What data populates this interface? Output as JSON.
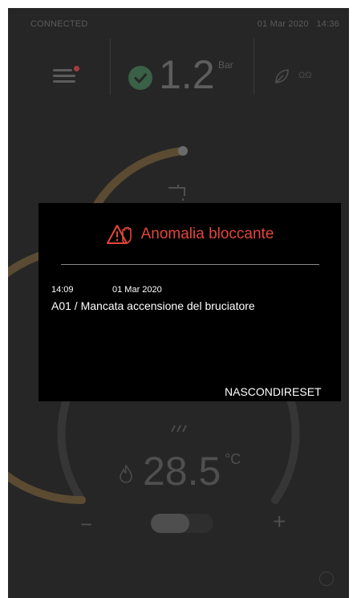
{
  "status_bar": {
    "connection": "CONNECTED",
    "date": "01 Mar 2020",
    "time": "14:36"
  },
  "top_bar": {
    "pressure_value": "1.2",
    "pressure_unit": "Bar",
    "mode_label": "ΩΩ"
  },
  "dial": {
    "temperature": "28.5",
    "temperature_unit": "°C",
    "minus_label": "−",
    "plus_label": "+"
  },
  "modal": {
    "title": "Anomalia bloccante",
    "event_time": "14:09",
    "event_date": "01 Mar 2020",
    "event_description": "A01 / Mancata accensione del bruciatore",
    "hide_label": "NASCONDI",
    "reset_label": "RESET"
  },
  "colors": {
    "alert_red": "#e4463b",
    "ok_green": "#3a6047",
    "background": "#262626",
    "modal_background": "#000000"
  }
}
